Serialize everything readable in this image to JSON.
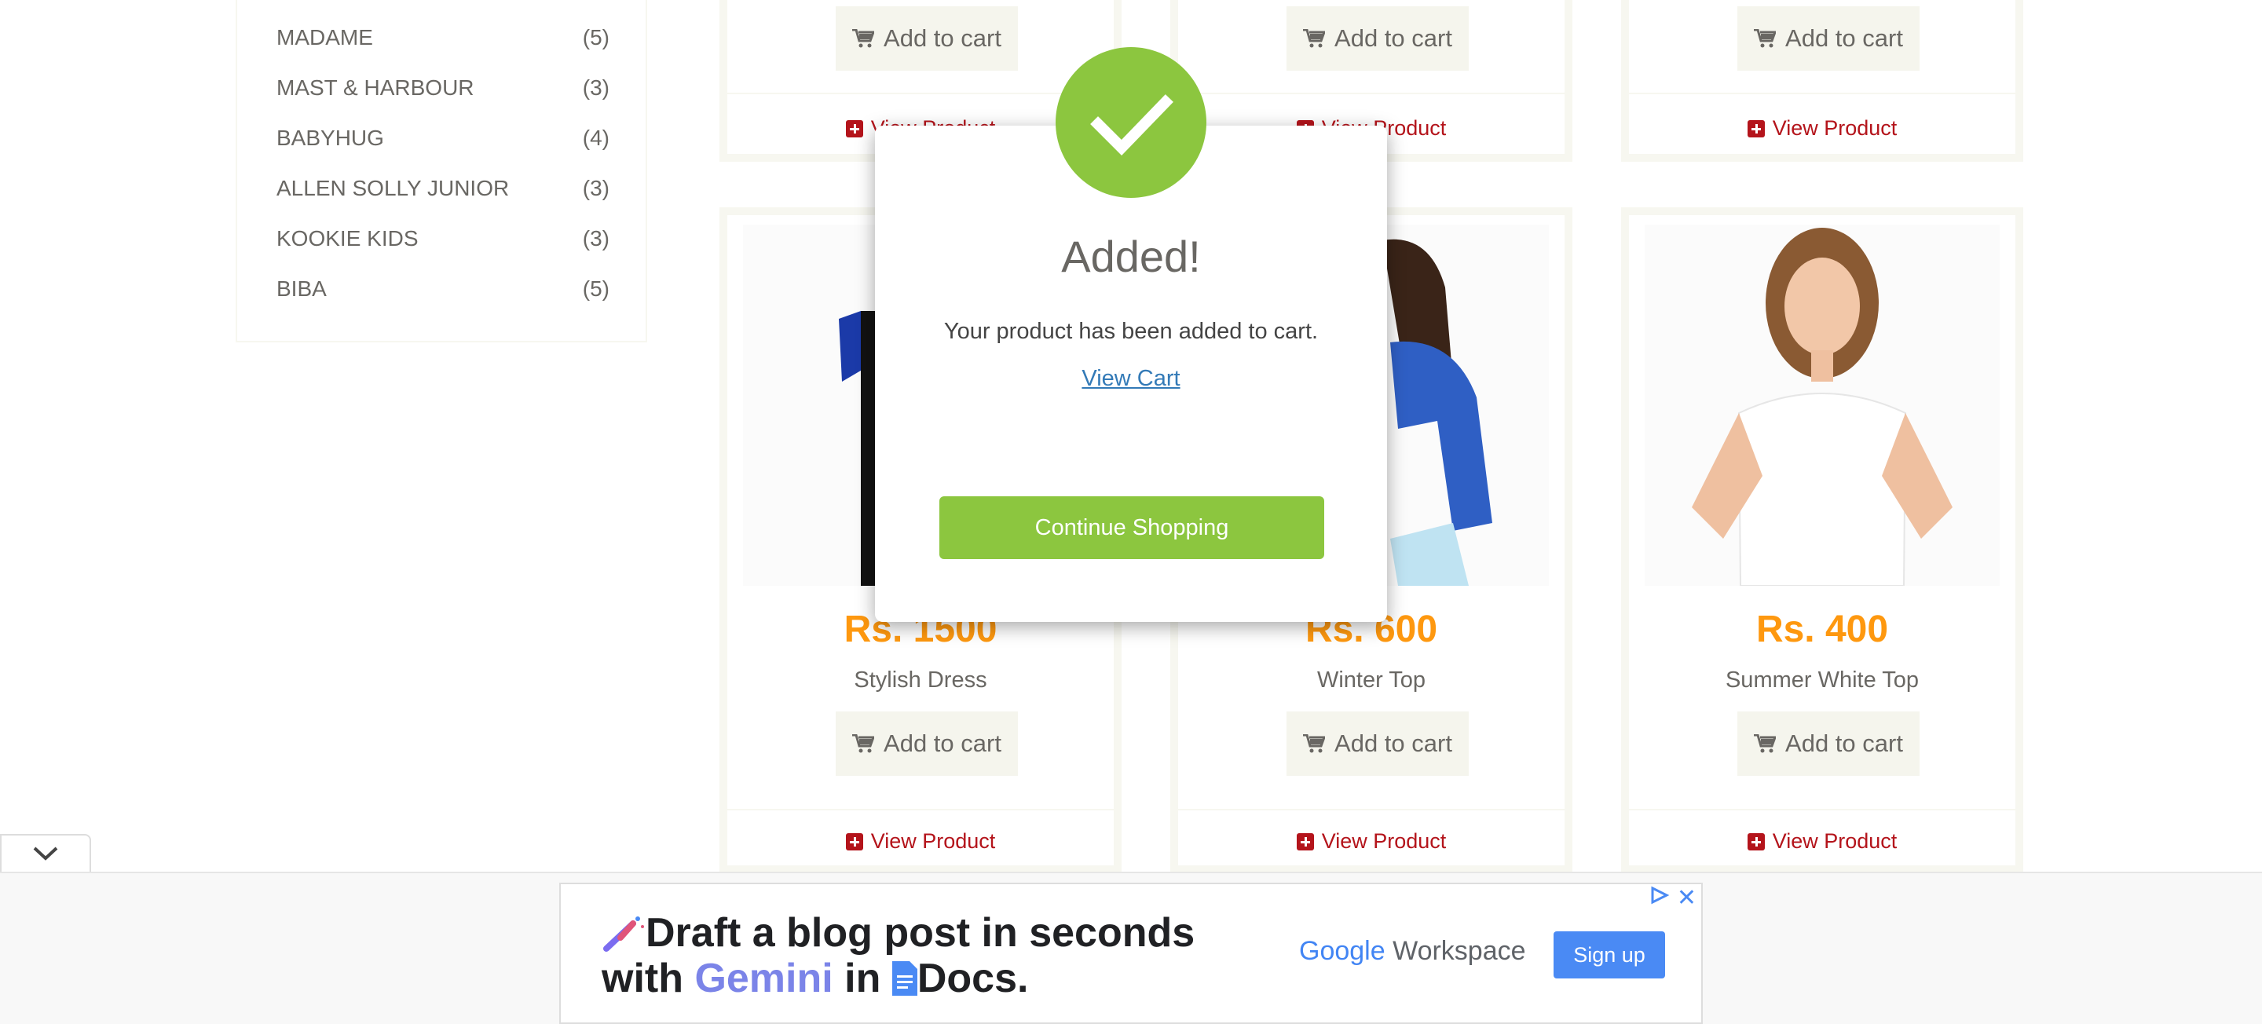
{
  "brands": [
    {
      "name": "MADAME",
      "count": "(5)"
    },
    {
      "name": "MAST & HARBOUR",
      "count": "(3)"
    },
    {
      "name": "BABYHUG",
      "count": "(4)"
    },
    {
      "name": "ALLEN SOLLY JUNIOR",
      "count": "(3)"
    },
    {
      "name": "KOOKIE KIDS",
      "count": "(3)"
    },
    {
      "name": "BIBA",
      "count": "(5)"
    }
  ],
  "top_cards": [
    {
      "add_to_cart": "Add to cart",
      "view_product": "View Product"
    },
    {
      "add_to_cart": "Add to cart",
      "view_product": "View Product"
    },
    {
      "add_to_cart": "Add to cart",
      "view_product": "View Product"
    }
  ],
  "products": [
    {
      "price": "Rs. 1500",
      "name": "Stylish Dress",
      "add_to_cart": "Add to cart",
      "view_product": "View Product"
    },
    {
      "price": "Rs. 600",
      "name": "Winter Top",
      "add_to_cart": "Add to cart",
      "view_product": "View Product"
    },
    {
      "price": "Rs. 400",
      "name": "Summer White Top",
      "add_to_cart": "Add to cart",
      "view_product": "View Product"
    }
  ],
  "modal": {
    "title": "Added!",
    "message": "Your product has been added to cart.",
    "view_cart": "View Cart",
    "continue": "Continue Shopping"
  },
  "ad": {
    "line1": "Draft a blog post in seconds",
    "line2_prefix": "with",
    "line2_gemini": "Gemini",
    "line2_in": "in",
    "line2_docs": "Docs.",
    "brand_google": "Google",
    "brand_workspace": "Workspace",
    "cta": "Sign up"
  },
  "colors": {
    "price": "#fe980f",
    "success": "#8cc63f",
    "link_red": "#b4141b",
    "link_blue": "#337ab7"
  }
}
